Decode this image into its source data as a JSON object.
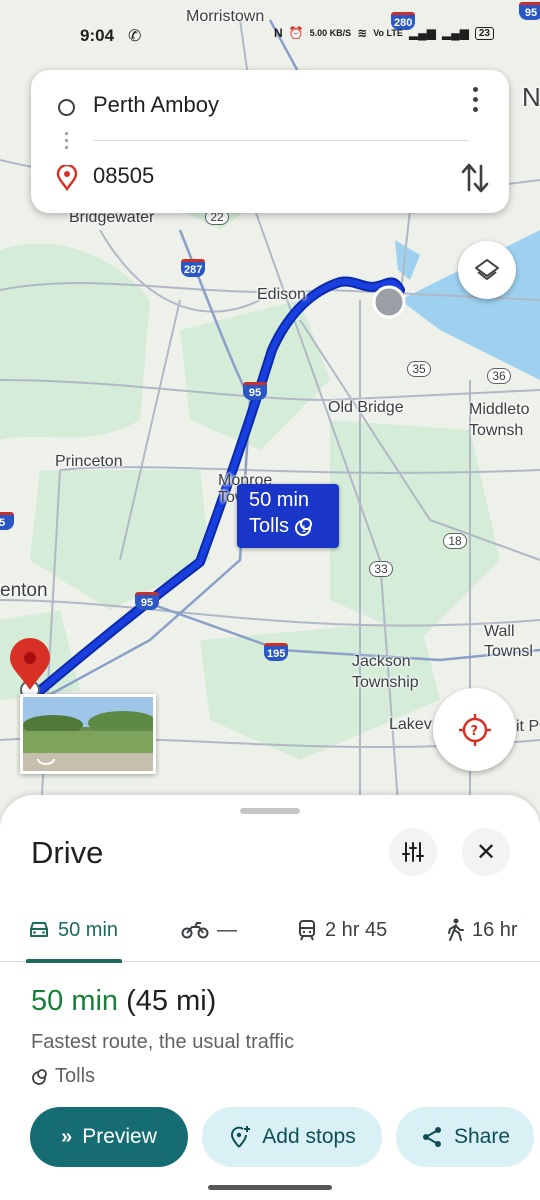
{
  "status_bar": {
    "time": "9:04",
    "net_speed": "5.00 KB/S",
    "net_type": "Vo LTE",
    "battery": "23"
  },
  "search": {
    "origin": "Perth Amboy",
    "destination": "08505"
  },
  "map": {
    "places": {
      "morristown": "Morristown",
      "bridgewater": "Bridgewater",
      "edison": "Edison",
      "old_bridge": "Old Bridge",
      "middletown": "Middleto\nTownsh",
      "princeton": "Princeton",
      "monroe": "Monroe\nTow",
      "trenton": "enton",
      "jackson": "Jackson\nTownship",
      "wall": "Wall\nTownsl",
      "lakewood": "Lakev",
      "pt": "it P",
      "n_edge": "N"
    },
    "shields": {
      "i280": "280",
      "i287": "287",
      "i95a": "95",
      "i95b": "95",
      "i195": "195",
      "i95top": "95",
      "i5": "5",
      "i22": "22"
    },
    "routes": {
      "r22": "22",
      "r35": "35",
      "r36": "36",
      "r18": "18",
      "r33": "33"
    },
    "eta_callout": {
      "duration": "50 min",
      "tolls": "Tolls"
    },
    "route_color": "#1a3fe0"
  },
  "sheet": {
    "title": "Drive",
    "modes": [
      {
        "icon": "car-icon",
        "label": "50 min"
      },
      {
        "icon": "motorcycle-icon",
        "label": "—"
      },
      {
        "icon": "transit-icon",
        "label": "2 hr 45"
      },
      {
        "icon": "walk-icon",
        "label": "16 hr"
      }
    ],
    "route": {
      "duration": "50 min",
      "distance": "(45 mi)",
      "summary": "Fastest route, the usual traffic",
      "tolls": "Tolls"
    },
    "buttons": {
      "preview": "Preview",
      "add_stops": "Add stops",
      "share": "Share"
    },
    "accent": "#166c73"
  }
}
